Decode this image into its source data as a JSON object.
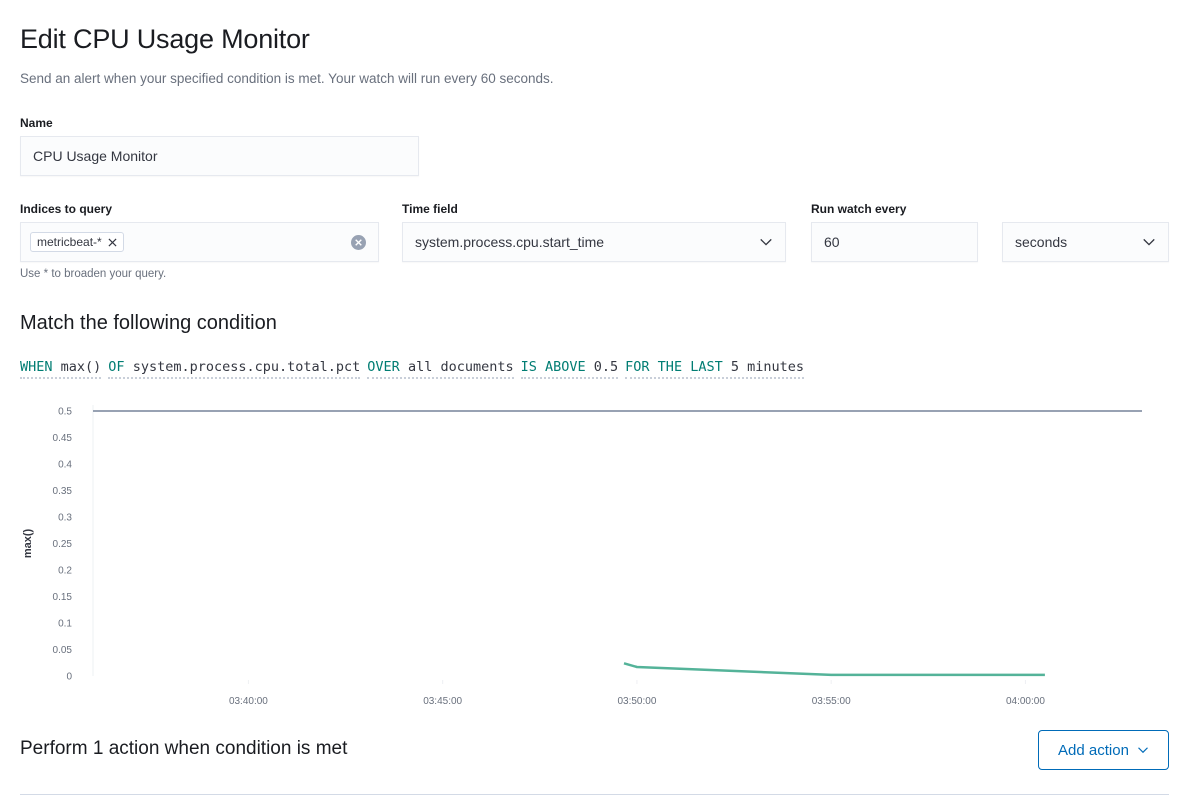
{
  "header": {
    "title": "Edit CPU Usage Monitor",
    "subtitle": "Send an alert when your specified condition is met. Your watch will run every 60 seconds."
  },
  "form": {
    "name": {
      "label": "Name",
      "value": "CPU Usage Monitor"
    },
    "indices": {
      "label": "Indices to query",
      "pill": "metricbeat-*",
      "help": "Use * to broaden your query."
    },
    "time_field": {
      "label": "Time field",
      "value": "system.process.cpu.start_time"
    },
    "run_every": {
      "label": "Run watch every",
      "value": "60",
      "unit": "seconds"
    }
  },
  "condition": {
    "heading": "Match the following condition",
    "tokens": [
      {
        "kw": "WHEN",
        "val": "max()"
      },
      {
        "kw": "OF",
        "val": "system.process.cpu.total.pct"
      },
      {
        "kw": "OVER",
        "val": "all documents"
      },
      {
        "kw": "IS ABOVE",
        "val": "0.5"
      },
      {
        "kw": "FOR THE LAST",
        "val": "5 minutes"
      }
    ]
  },
  "chart_data": {
    "type": "line",
    "ylabel": "max()",
    "xlabel": "",
    "ylim": [
      0,
      0.5
    ],
    "yticks": [
      "0",
      "0.05",
      "0.1",
      "0.15",
      "0.2",
      "0.25",
      "0.3",
      "0.35",
      "0.4",
      "0.45",
      "0.5"
    ],
    "xlim_minutes": [
      "03:36:00",
      "04:03:00"
    ],
    "xticks": [
      "03:40:00",
      "03:45:00",
      "03:50:00",
      "03:55:00",
      "04:00:00"
    ],
    "threshold": 0.5,
    "series": [
      {
        "x": [
          "03:49:40",
          "03:50:00",
          "03:55:00",
          "04:00:00",
          "04:00:30"
        ],
        "values": [
          0.024,
          0.017,
          0.002,
          0.002,
          0.002
        ],
        "color": "#54b399"
      }
    ],
    "threshold_color": "#98a2b3",
    "grid": false
  },
  "actions": {
    "heading": "Perform 1 action when condition is met",
    "add_label": "Add action"
  }
}
